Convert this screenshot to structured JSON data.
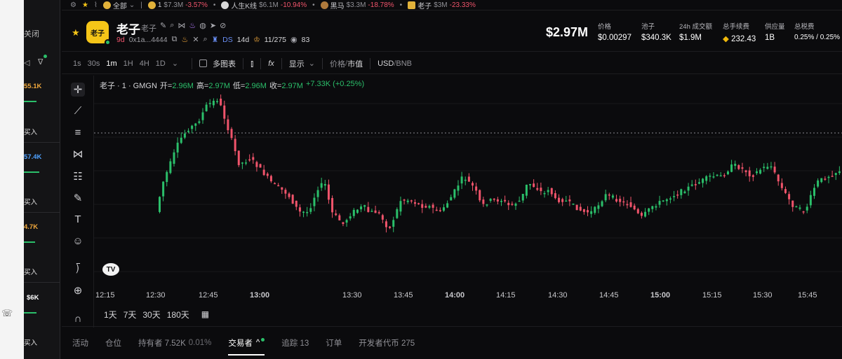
{
  "left_panel": {
    "close_label": "关闭",
    "rows": [
      {
        "value": "55.1K",
        "value_color": "#f0a83c"
      },
      {
        "buy_label": "买入"
      },
      {
        "value": "57.4K",
        "value_color": "#4ea1ff"
      },
      {
        "buy_label": "买入"
      },
      {
        "value": "4.7K",
        "value_color": "#f0a83c"
      },
      {
        "buy_label": "买入"
      },
      {
        "value": "$6K",
        "value_color": "#ffffff"
      },
      {
        "buy_label": "买入"
      }
    ]
  },
  "ticker": {
    "filter": "全部",
    "items": [
      {
        "name": "1",
        "mcap": "$7.3M",
        "change": "-3.57%"
      },
      {
        "name": "人生K线",
        "mcap": "$6.1M",
        "change": "-10.94%"
      },
      {
        "name": "黑马",
        "mcap": "$3.3M",
        "change": "-18.78%"
      },
      {
        "name": "老子",
        "mcap": "$3M",
        "change": "-23.33%"
      }
    ]
  },
  "token": {
    "logo_text": "老子",
    "name": "老子",
    "symbol": "老子",
    "age": "9d",
    "address": "0x1a...4444",
    "dev_label": "DS",
    "dev_age": "14d",
    "holders_ratio": "11/275",
    "watchers": "83",
    "market_cap": "$2.97M"
  },
  "stats": [
    {
      "label": "价格",
      "value": "$0.00297"
    },
    {
      "label": "池子",
      "value": "$340.3K"
    },
    {
      "label": "24h 成交额",
      "value": "$1.9M"
    },
    {
      "label": "总手续费",
      "value": "232.43"
    },
    {
      "label": "供应量",
      "value": "1B"
    },
    {
      "label": "总税费",
      "value": "0.25% / 0.25%"
    }
  ],
  "toolbar": {
    "intervals": [
      "1s",
      "30s",
      "1m",
      "1H",
      "4H",
      "1D"
    ],
    "active_interval": "1m",
    "multi_chart": "多图表",
    "display": "显示",
    "price_label": "价格",
    "mcap_label": "市值",
    "usd_label": "USD",
    "bnb_label": "BNB"
  },
  "legend": {
    "title": "老子 · 1 · GMGN",
    "open_label": "开=",
    "open": "2.96M",
    "high_label": "高=",
    "high": "2.97M",
    "low_label": "低=",
    "low": "2.96M",
    "close_label": "收=",
    "close": "2.97M",
    "change": "+7.33K (+0.25%)"
  },
  "chart_data": {
    "type": "candlestick",
    "x_ticks": [
      "12:15",
      "12:30",
      "12:45",
      "13:00",
      "13:30",
      "13:45",
      "14:00",
      "14:15",
      "14:30",
      "14:45",
      "15:00",
      "15:15",
      "15:30",
      "15:45"
    ],
    "bold_ticks": [
      "13:00",
      "14:00",
      "15:00"
    ],
    "up_color": "#2bbf6a",
    "down_color": "#f0546b",
    "dotted_level_note": "dotted horizontal price line near top"
  },
  "range": {
    "options": [
      "1天",
      "7天",
      "30天",
      "180天"
    ]
  },
  "bottom_tabs": [
    {
      "label": "活动",
      "active": false
    },
    {
      "label": "仓位",
      "active": false
    },
    {
      "label": "持有者 7.52K",
      "extra": "0.01%",
      "active": false
    },
    {
      "label": "交易者",
      "active": true
    },
    {
      "label": "追踪 13",
      "active": false
    },
    {
      "label": "订单",
      "active": false
    },
    {
      "label": "开发者代币 275",
      "active": false
    }
  ]
}
